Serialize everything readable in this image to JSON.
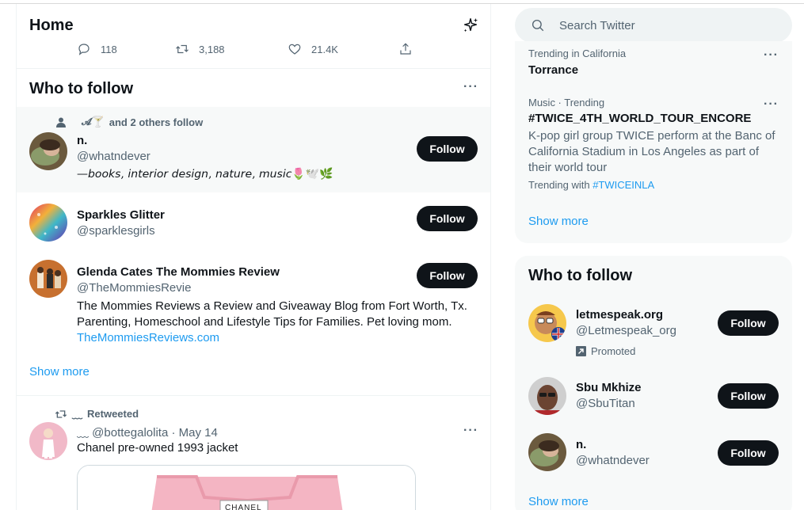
{
  "home": {
    "title": "Home",
    "sparkle_icon": "sparkle-icon"
  },
  "tweet_actions": {
    "replies": "118",
    "retweets": "3,188",
    "likes": "21.4K"
  },
  "who_to_follow": {
    "title": "Who to follow",
    "follow_label": "Follow",
    "users": [
      {
        "social": "and 2 others follow",
        "social_prefix": "𝓐🍸",
        "name": "n.",
        "handle": "@whatndever",
        "bio": "—𝘣𝘰𝘰𝘬𝘴, 𝘪𝘯𝘵𝘦𝘳𝘪𝘰𝘳 𝘥𝘦𝘴𝘪𝘨𝘯, 𝘯𝘢𝘵𝘶𝘳𝘦, 𝘮𝘶𝘴𝘪𝘤🌷🕊️🌿"
      },
      {
        "name": "Sparkles Glitter",
        "handle": "@sparklesgirls"
      },
      {
        "name": "Glenda Cates The Mommies Review",
        "handle": "@TheMommiesRevie",
        "bio": "The Mommies Reviews a Review and Giveaway Blog from Fort Worth, Tx. Parenting, Homeschool and Lifestyle Tips for Families. Pet loving mom.",
        "link": "TheMommiesReviews.com"
      }
    ],
    "show_more": "Show more"
  },
  "retweet": {
    "label": "Retweeted",
    "label_prefix": "﹏",
    "author": "﹏ @bottegalolita · May 14",
    "text": "Chanel pre-owned 1993 jacket",
    "media_text": "CHANEL"
  },
  "search": {
    "placeholder": "Search Twitter"
  },
  "trends": [
    {
      "category": "Trending in California",
      "name": "Torrance"
    },
    {
      "category": "Music · Trending",
      "name": "#TWICE_4TH_WORLD_TOUR_ENCORE",
      "description": "K-pop girl group TWICE perform at the Banc of California Stadium in Los Angeles as part of their world tour",
      "trending_with_label": "Trending with",
      "trending_with_tag": "#TWICEINLA"
    }
  ],
  "trends_show_more": "Show more",
  "sidebar_follow": {
    "title": "Who to follow",
    "follow_label": "Follow",
    "users": [
      {
        "name": "letmespeak.org",
        "handle": "@Letmespeak_org",
        "promoted": "Promoted"
      },
      {
        "name": "Sbu Mkhize",
        "handle": "@SbuTitan"
      },
      {
        "name": "n.",
        "handle": "@whatndever"
      }
    ],
    "show_more": "Show more"
  },
  "colors": {
    "accent": "#1d9bf0",
    "text": "#0f1419",
    "secondary": "#536471",
    "panel": "#f7f9f9",
    "button": "#0f1419"
  }
}
